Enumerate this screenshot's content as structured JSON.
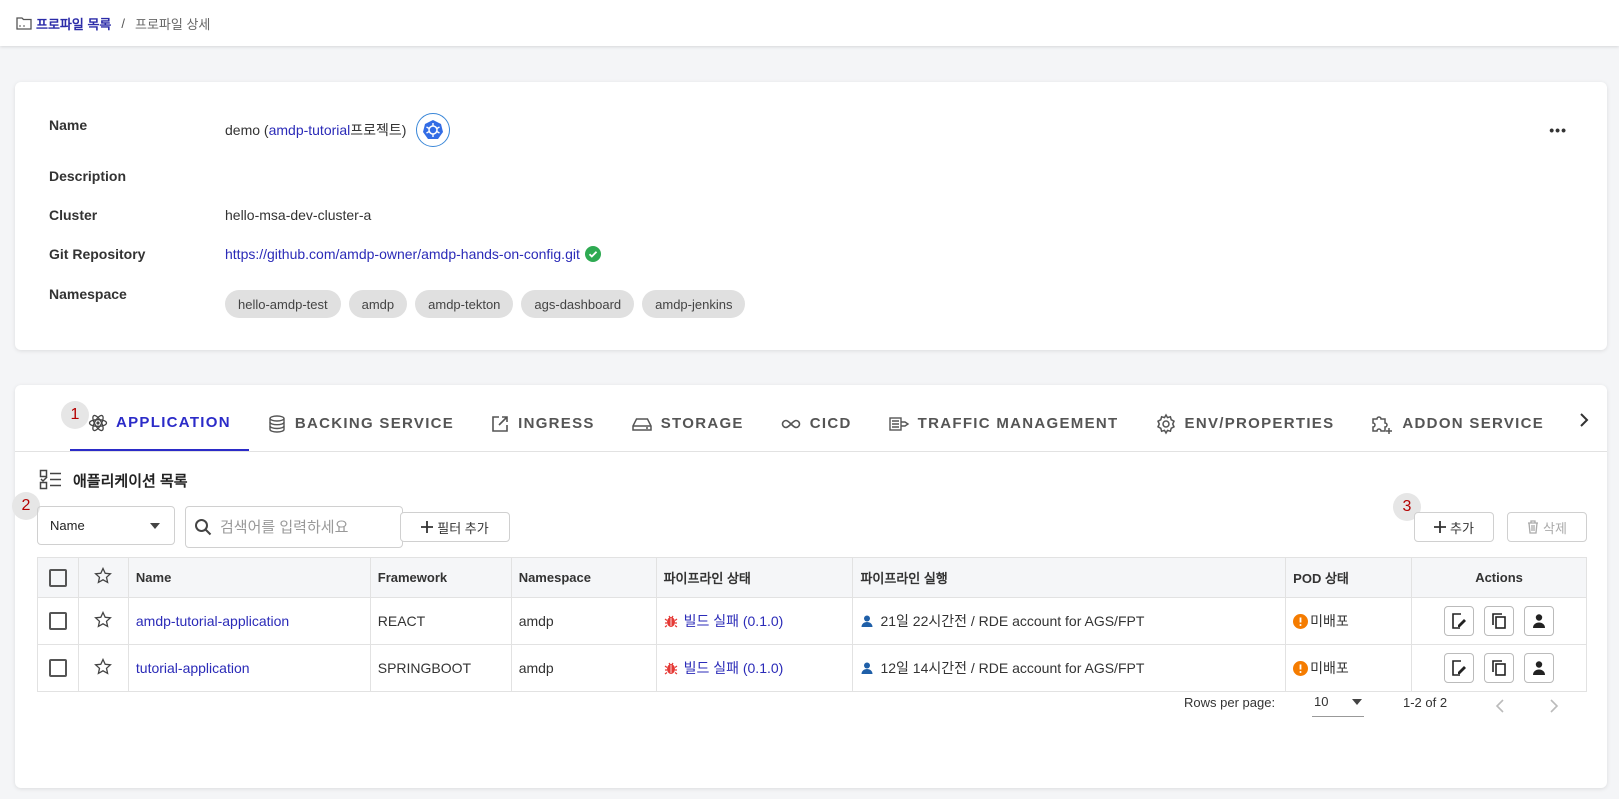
{
  "breadcrumb": {
    "root": "프로파일 목록",
    "separator": "/",
    "current": "프로파일 상세"
  },
  "profile": {
    "name_label": "Name",
    "name_prefix": "demo (",
    "name_project": "amdp-tutorial",
    "name_suffix": "프로젝트)",
    "description_label": "Description",
    "description_value": "",
    "cluster_label": "Cluster",
    "cluster_value": "hello-msa-dev-cluster-a",
    "git_label": "Git Repository",
    "git_value": "https://github.com/amdp-owner/amdp-hands-on-config.git",
    "namespace_label": "Namespace",
    "namespaces": [
      "hello-amdp-test",
      "amdp",
      "amdp-tekton",
      "ags-dashboard",
      "amdp-jenkins"
    ],
    "more": "•••"
  },
  "tabs": [
    "APPLICATION",
    "BACKING SERVICE",
    "INGRESS",
    "STORAGE",
    "CICD",
    "TRAFFIC MANAGEMENT",
    "ENV/PROPERTIES",
    "ADDON SERVICE"
  ],
  "badges": [
    "1",
    "2",
    "3"
  ],
  "section_title": "애플리케이션 목록",
  "filter": {
    "field_value": "Name",
    "search_placeholder": "검색어를 입력하세요",
    "add_filter_label": "필터 추가",
    "add_label": "추가",
    "delete_label": "삭제"
  },
  "table": {
    "headers": [
      "Name",
      "Framework",
      "Namespace",
      "파이프라인 상태",
      "파이프라인 실행",
      "POD 상태",
      "Actions"
    ],
    "rows": [
      {
        "name": "amdp-tutorial-application",
        "framework": "REACT",
        "namespace": "amdp",
        "pipeline_status": "빌드 실패 (0.1.0)",
        "pipeline_exec": "21일 22시간전 / RDE account for AGS/FPT",
        "pod_status": "미배포"
      },
      {
        "name": "tutorial-application",
        "framework": "SPRINGBOOT",
        "namespace": "amdp",
        "pipeline_status": "빌드 실패 (0.1.0)",
        "pipeline_exec": "12일 14시간전 / RDE account for AGS/FPT",
        "pod_status": "미배포"
      }
    ]
  },
  "pagination": {
    "rows_label": "Rows per page:",
    "rows_value": "10",
    "range": "1-2 of 2"
  },
  "colors": {
    "accent": "#2b2bc8",
    "link": "#2b2bb8",
    "error": "#e53935",
    "warning": "#f57c00",
    "badge_text": "#b40000"
  }
}
